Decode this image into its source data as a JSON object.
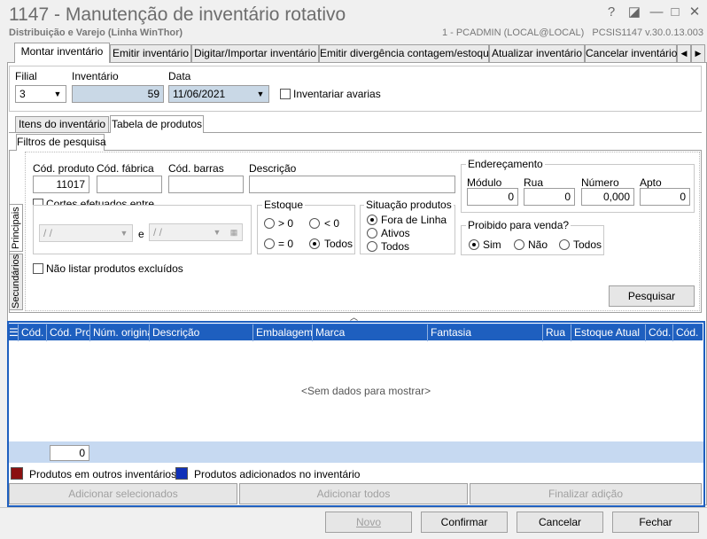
{
  "window": {
    "title": "1147 - Manutenção de inventário rotativo",
    "subtitle": "Distribuição e Varejo (Linha WinThor)",
    "user": "1 - PCADMIN (LOCAL@LOCAL)",
    "version": "PCSIS1147  v.30.0.13.003",
    "help": "?",
    "restore": "◪",
    "minimize": "—",
    "maximize": "□",
    "close": "✕"
  },
  "tabs": [
    "Montar inventário",
    "Emitir inventário",
    "Digitar/Importar inventário",
    "Emitir divergência contagem/estoque",
    "Atualizar inventário",
    "Cancelar inventário"
  ],
  "tab_nav": {
    "left": "◀",
    "right": "▶"
  },
  "header": {
    "filial_label": "Filial",
    "filial_value": "3",
    "inventario_label": "Inventário",
    "inventario_value": "59",
    "data_label": "Data",
    "data_value": "11/06/2021",
    "avarias_label": "Inventariar avarias"
  },
  "subtabs": [
    "Itens do inventário",
    "Tabela de produtos"
  ],
  "filter_tab": "Filtros de pesquisa",
  "side_tabs": [
    "Principais",
    "Secundários"
  ],
  "filters": {
    "cod_produto_label": "Cód. produto",
    "cod_produto_value": "11017",
    "cod_fabrica_label": "Cód. fábrica",
    "cod_barras_label": "Cód. barras",
    "descricao_label": "Descrição",
    "cortes_label": "Cortes efetuados entre",
    "date_placeholder": " / /",
    "e_label": "e",
    "estoque_label": "Estoque",
    "estoque_opts": [
      "> 0",
      "< 0",
      "= 0",
      "Todos"
    ],
    "situacao_label": "Situação produtos",
    "situacao_opts": [
      "Fora de Linha",
      "Ativos",
      "Todos"
    ],
    "nao_listar_label": "Não listar produtos excluídos",
    "enderecamento_label": "Endereçamento",
    "modulo_label": "Módulo",
    "modulo_value": "0",
    "rua_label": "Rua",
    "rua_value": "0",
    "numero_label": "Número",
    "numero_value": "0,000",
    "apto_label": "Apto",
    "apto_value": "0",
    "proibido_label": "Proibido para venda?",
    "proibido_opts": [
      "Sim",
      "Não",
      "Todos"
    ],
    "pesquisar": "Pesquisar"
  },
  "grid": {
    "columns": [
      "Cód. I",
      "Cód. Pro",
      "Núm. original",
      "Descrição",
      "Embalagem",
      "Marca",
      "Fantasia",
      "Rua",
      "Estoque Atual",
      "Cód.",
      "Cód."
    ],
    "empty": "<Sem dados para mostrar>",
    "count": "0"
  },
  "legend": [
    {
      "label": "Produtos em outros inventários",
      "color": "#8b1010"
    },
    {
      "label": "Produtos adicionados no inventário",
      "color": "#1030b8"
    }
  ],
  "actions": [
    "Adicionar selecionados",
    "Adicionar todos",
    "Finalizar adição"
  ],
  "footer": {
    "novo": "Novo",
    "confirmar": "Confirmar",
    "cancelar": "Cancelar",
    "fechar": "Fechar"
  }
}
